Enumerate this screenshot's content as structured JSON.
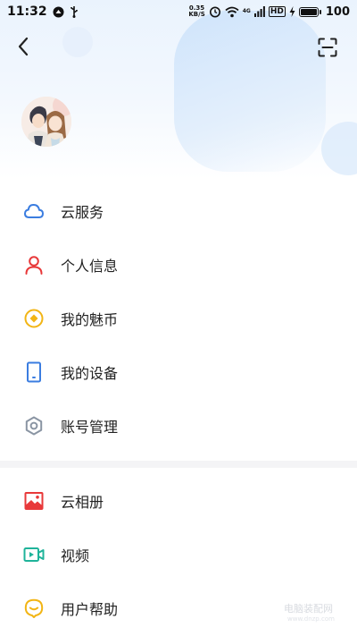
{
  "status_bar": {
    "time": "11:32",
    "net_speed_value": "0.35",
    "net_speed_unit": "KB/S",
    "network_badge": "4G",
    "hd_badge": "HD",
    "battery_level": "100"
  },
  "menu_primary": [
    {
      "label": "云服务",
      "icon": "cloud-icon",
      "color": "#3b7de0"
    },
    {
      "label": "个人信息",
      "icon": "person-icon",
      "color": "#e8393a"
    },
    {
      "label": "我的魅币",
      "icon": "coin-icon",
      "color": "#f2b515"
    },
    {
      "label": "我的设备",
      "icon": "phone-device-icon",
      "color": "#3b7de0"
    },
    {
      "label": "账号管理",
      "icon": "gear-icon",
      "color": "#8a95a3"
    }
  ],
  "menu_secondary": [
    {
      "label": "云相册",
      "icon": "photo-album-icon",
      "color": "#e8393a"
    },
    {
      "label": "视频",
      "icon": "video-icon",
      "color": "#1fb39a"
    },
    {
      "label": "用户帮助",
      "icon": "help-chat-icon",
      "color": "#f2b515"
    }
  ],
  "watermark": {
    "text": "电脑装配网",
    "sub": "www.dnzp.com"
  }
}
